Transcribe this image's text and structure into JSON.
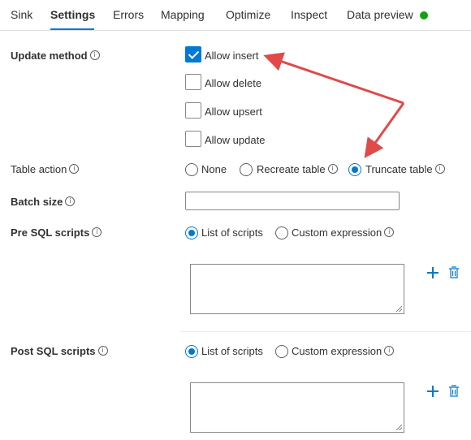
{
  "tabs": [
    {
      "label": "Sink"
    },
    {
      "label": "Settings"
    },
    {
      "label": "Errors"
    },
    {
      "label": "Mapping"
    },
    {
      "label": "Optimize"
    },
    {
      "label": "Inspect"
    },
    {
      "label": "Data preview"
    }
  ],
  "active_tab": "Settings",
  "status_color": "#13a10e",
  "accent_color": "#0078d4",
  "annotation_color": "#e04a4a",
  "update_method": {
    "label": "Update method",
    "options": [
      {
        "label": "Allow insert",
        "checked": true
      },
      {
        "label": "Allow delete",
        "checked": false
      },
      {
        "label": "Allow upsert",
        "checked": false
      },
      {
        "label": "Allow update",
        "checked": false
      }
    ]
  },
  "table_action": {
    "label": "Table action",
    "options": [
      "None",
      "Recreate table",
      "Truncate table"
    ],
    "selected": "Truncate table"
  },
  "batch_size": {
    "label": "Batch size",
    "value": ""
  },
  "pre_sql": {
    "label": "Pre SQL scripts",
    "options": [
      "List of scripts",
      "Custom expression"
    ],
    "selected": "List of scripts",
    "value": ""
  },
  "post_sql": {
    "label": "Post SQL scripts",
    "options": [
      "List of scripts",
      "Custom expression"
    ],
    "selected": "List of scripts",
    "value": ""
  },
  "icons": {
    "info": "info-icon",
    "add": "plus-icon",
    "delete": "trash-icon",
    "status": "status-dot-icon"
  },
  "info_glyph": "i"
}
